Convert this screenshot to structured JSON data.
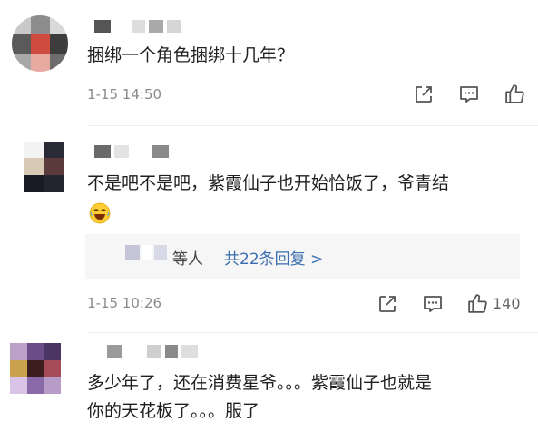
{
  "comments": [
    {
      "text_lines": [
        "捆绑一个角色捆绑十几年？"
      ],
      "time": "1-15 14:50",
      "like_count": ""
    },
    {
      "text_lines": [
        "不是吧不是吧，紫霞仙子也开始恰饭了，爷青结"
      ],
      "time": "1-15 10:26",
      "like_count": "140",
      "reply": {
        "suffix": "等人",
        "link": "共22条回复 >"
      },
      "emoji": "laughing-crying-emoji"
    },
    {
      "text_lines": [
        "多少年了，还在消费星爷。。。紫霞仙子也就是",
        "你的天花板了。。。服了"
      ]
    }
  ],
  "icons": {
    "repost": "repost-icon",
    "comment": "comment-icon",
    "like": "thumbs-up-icon"
  },
  "colors": {
    "link": "#3b6db0",
    "meta": "#8a8a8a"
  }
}
